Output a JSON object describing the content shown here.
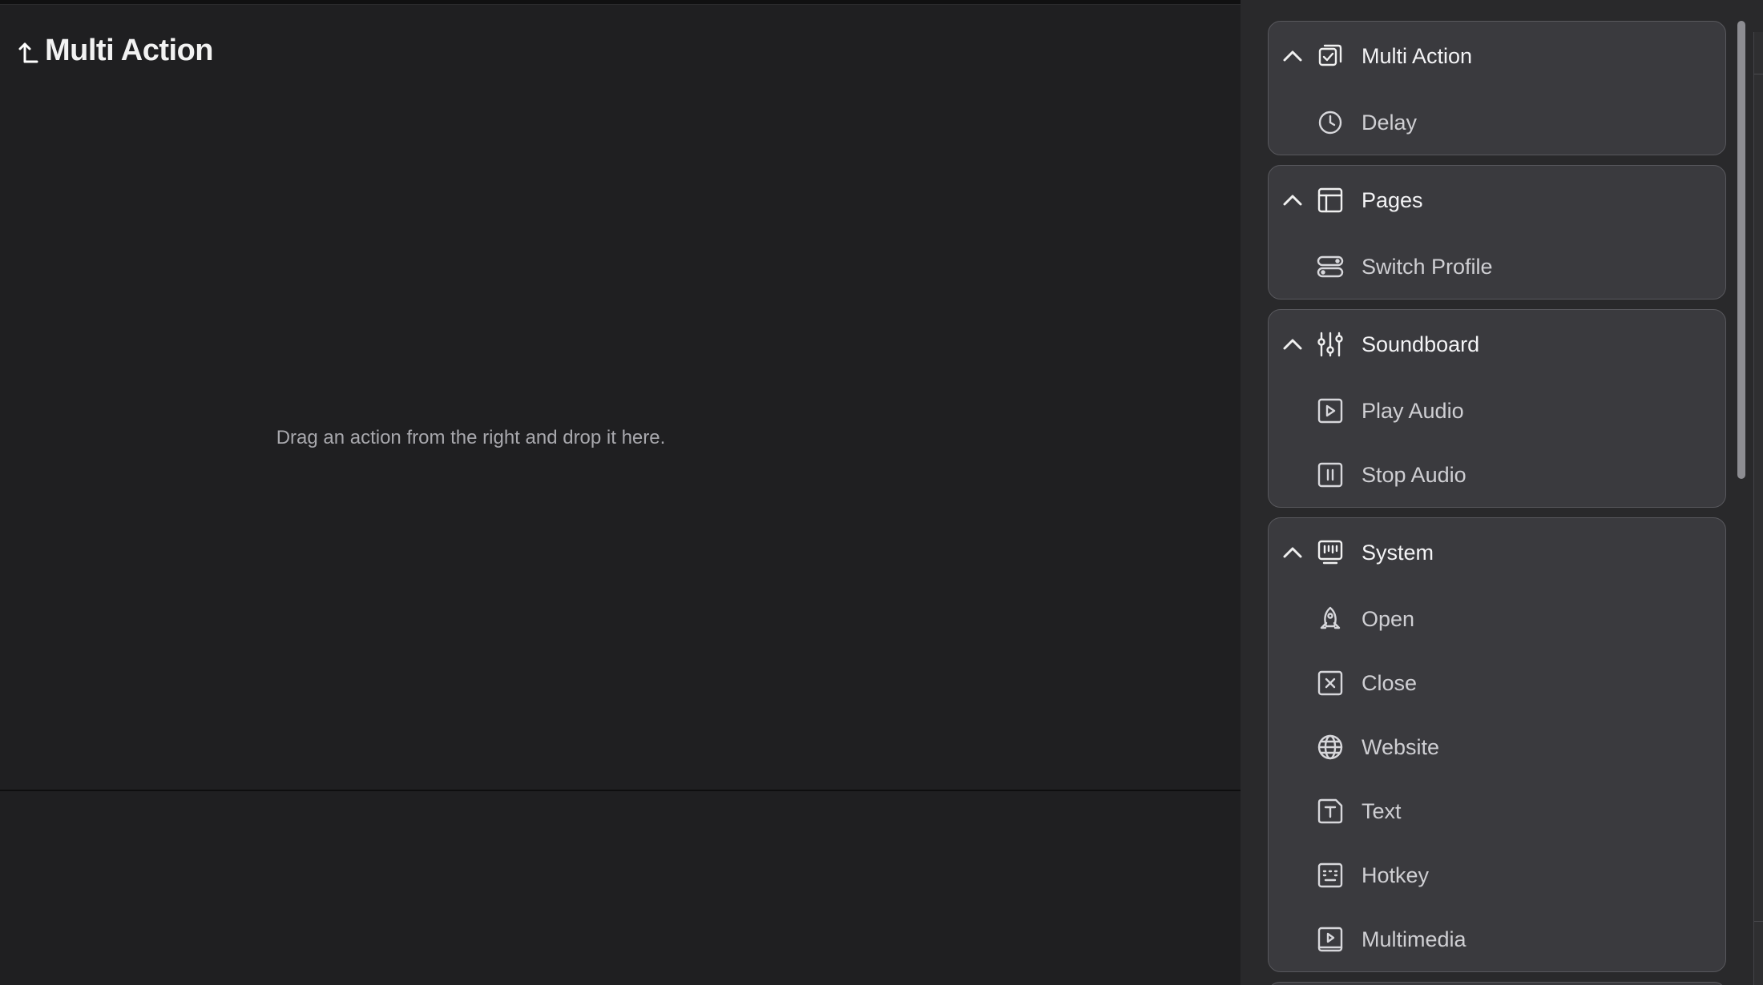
{
  "editor": {
    "title": "Multi Action",
    "dropzone_hint": "Drag an action from the right and drop it here."
  },
  "library": {
    "groups": [
      {
        "name": "Multi Action",
        "icon": "checkbox-icon",
        "expanded": true,
        "items": [
          {
            "label": "Delay",
            "icon": "clock-icon"
          }
        ]
      },
      {
        "name": "Pages",
        "icon": "layout-icon",
        "expanded": true,
        "items": [
          {
            "label": "Switch Profile",
            "icon": "toggle-profile-icon"
          }
        ]
      },
      {
        "name": "Soundboard",
        "icon": "sliders-icon",
        "expanded": true,
        "items": [
          {
            "label": "Play Audio",
            "icon": "play-square-icon"
          },
          {
            "label": "Stop Audio",
            "icon": "pause-square-icon"
          }
        ]
      },
      {
        "name": "System",
        "icon": "keyboard-monitor-icon",
        "expanded": true,
        "items": [
          {
            "label": "Open",
            "icon": "rocket-icon"
          },
          {
            "label": "Close",
            "icon": "close-square-icon"
          },
          {
            "label": "Website",
            "icon": "globe-icon"
          },
          {
            "label": "Text",
            "icon": "text-square-icon"
          },
          {
            "label": "Hotkey",
            "icon": "hotkey-square-icon"
          },
          {
            "label": "Multimedia",
            "icon": "media-icon"
          }
        ]
      }
    ]
  }
}
